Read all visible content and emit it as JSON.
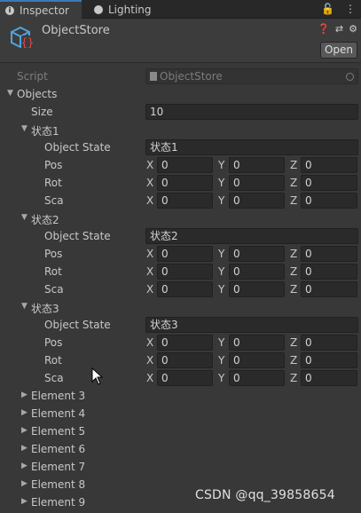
{
  "tabs": [
    {
      "label": "Inspector",
      "icon": "info-icon"
    },
    {
      "label": "Lighting",
      "icon": "bulb-icon"
    }
  ],
  "tab_tools": {
    "lock": "🔓",
    "menu": "⋮"
  },
  "header": {
    "title": "ObjectStore",
    "icons": [
      "help-icon",
      "preset-icon",
      "gear-icon"
    ],
    "open_label": "Open"
  },
  "script": {
    "label": "Script",
    "value": "ObjectStore"
  },
  "objects": {
    "label": "Objects",
    "size_label": "Size",
    "size_value": "10"
  },
  "states": [
    {
      "name": "状态1",
      "object_state_label": "Object State",
      "object_state_value": "状态1",
      "pos_label": "Pos",
      "rot_label": "Rot",
      "sca_label": "Sca",
      "pos": [
        "0",
        "0",
        "0"
      ],
      "rot": [
        "0",
        "0",
        "0"
      ],
      "sca": [
        "0",
        "0",
        "0"
      ]
    },
    {
      "name": "状态2",
      "object_state_label": "Object State",
      "object_state_value": "状态2",
      "pos_label": "Pos",
      "rot_label": "Rot",
      "sca_label": "Sca",
      "pos": [
        "0",
        "0",
        "0"
      ],
      "rot": [
        "0",
        "0",
        "0"
      ],
      "sca": [
        "0",
        "0",
        "0"
      ]
    },
    {
      "name": "状态3",
      "object_state_label": "Object State",
      "object_state_value": "状态3",
      "pos_label": "Pos",
      "rot_label": "Rot",
      "sca_label": "Sca",
      "pos": [
        "0",
        "0",
        "0"
      ],
      "rot": [
        "0",
        "0",
        "0"
      ],
      "sca": [
        "0",
        "0",
        "0"
      ]
    }
  ],
  "axis_labels": [
    "X",
    "Y",
    "Z"
  ],
  "elements": [
    "Element 3",
    "Element 4",
    "Element 5",
    "Element 6",
    "Element 7",
    "Element 8",
    "Element 9"
  ],
  "watermark": "CSDN @qq_39858654",
  "colors": {
    "accent": "#3a79bb",
    "field_bg": "#2a2a2a",
    "panel_bg": "#383838"
  }
}
